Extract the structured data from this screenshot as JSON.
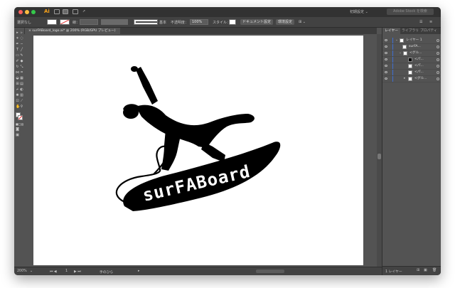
{
  "app": {
    "badge": "Ai",
    "workspace_label": "初期設定 ⌄",
    "search_placeholder": "Adobe Stock を検索"
  },
  "control_bar": {
    "selection_label": "選択なし",
    "stroke_label": "線：",
    "brush_label": "基本",
    "opacity_label": "不透明度：",
    "opacity_value": "100%",
    "style_label": "スタイル：",
    "document_setup_button": "ドキュメント設定",
    "preferences_button": "環境設定"
  },
  "document_tab": {
    "title": "surFABoard_logo.ai* @ 200% (RGB/GPU プレビュー)",
    "close_glyph": "×"
  },
  "artwork": {
    "logo_text": "surFABoard"
  },
  "status_bar": {
    "zoom": "200%",
    "artboard_number": "1",
    "tool_name": "手のひら"
  },
  "layers_panel": {
    "tabs": [
      "レイヤー",
      "ライブラリ",
      "プロパティ"
    ],
    "rows": [
      {
        "name": "レイヤー 1"
      },
      {
        "name": "surFA..."
      },
      {
        "name": "<グル..."
      },
      {
        "name": "<パ..."
      },
      {
        "name": "<パ..."
      },
      {
        "name": "<パ..."
      },
      {
        "name": "<グル..."
      }
    ],
    "footer_label": "1 レイヤー"
  },
  "colors": {
    "ui_dark": "#323232",
    "ui_mid": "#535353",
    "ui_panel": "#424242",
    "accent_orange": "#f7a21b",
    "artwork_fill": "#000000"
  }
}
